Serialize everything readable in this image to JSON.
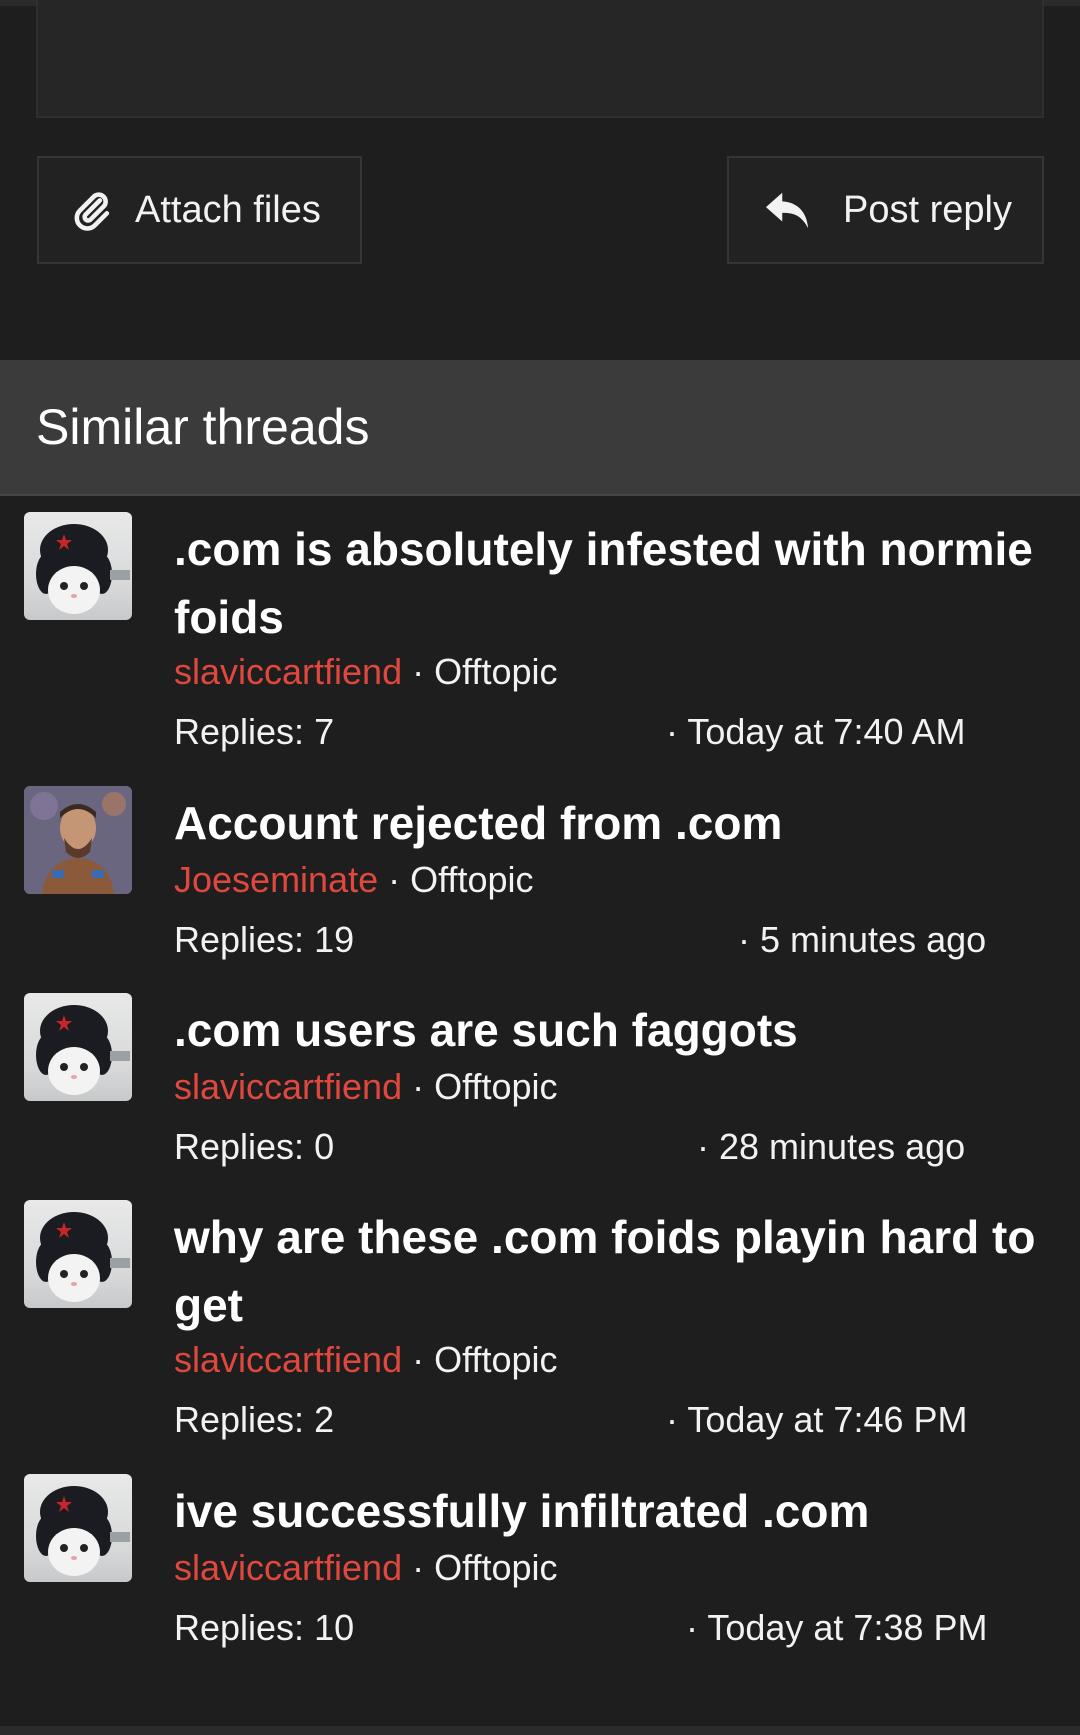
{
  "actions": {
    "attach_label": "Attach files",
    "reply_label": "Post reply",
    "attach_icon": "paperclip-icon",
    "reply_icon": "reply-arrow-icon"
  },
  "similar": {
    "heading": "Similar threads",
    "threads": [
      {
        "title": ".com is absolutely infested with normie foids",
        "author": "slaviccartfiend",
        "forum": "Offtopic",
        "replies": "Replies: 7",
        "date": "Today at 7:40 AM",
        "avatar": "cat-ushanka-avatar"
      },
      {
        "title": "Account rejected from .com",
        "author": "Joeseminate",
        "forum": "Offtopic",
        "replies": "Replies: 19",
        "date": "5 minutes ago",
        "avatar": "painted-portrait-avatar"
      },
      {
        "title": ".com users are such faggots",
        "author": "slaviccartfiend",
        "forum": "Offtopic",
        "replies": "Replies: 0",
        "date": "28 minutes ago",
        "avatar": "cat-ushanka-avatar"
      },
      {
        "title": "why are these .com foids playin hard to get",
        "author": "slaviccartfiend",
        "forum": "Offtopic",
        "replies": "Replies: 2",
        "date": "Today at 7:46 PM",
        "avatar": "cat-ushanka-avatar"
      },
      {
        "title": "ive successfully infiltrated .com",
        "author": "slaviccartfiend",
        "forum": "Offtopic",
        "replies": "Replies: 10",
        "date": "Today at 7:38 PM",
        "avatar": "cat-ushanka-avatar"
      }
    ]
  },
  "colors": {
    "background": "#1e1e1e",
    "header_bg": "#3b3b3b",
    "author": "#e0483e"
  }
}
